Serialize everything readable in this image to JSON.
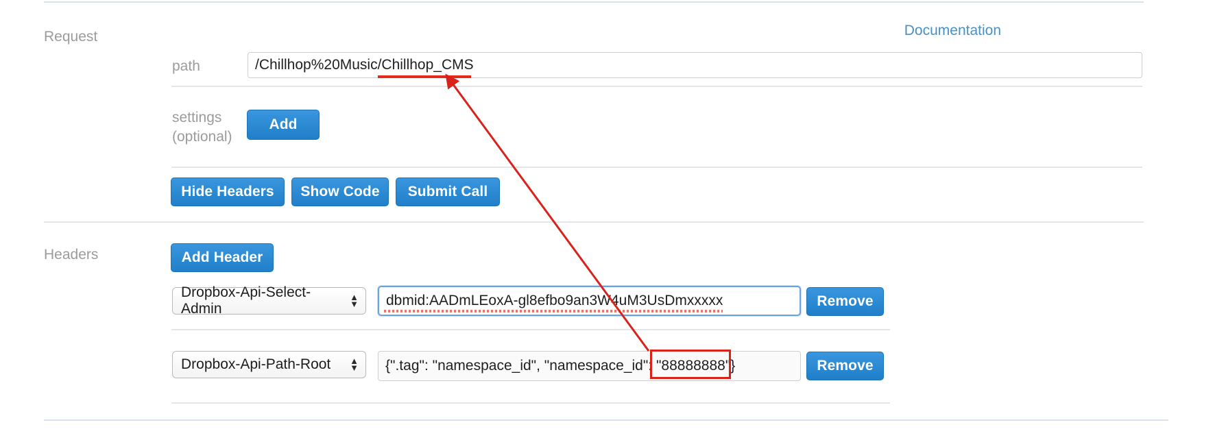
{
  "request": {
    "section_label": "Request",
    "documentation_link": "Documentation",
    "path": {
      "label": "path",
      "value": "/Chillhop%20Music/Chillhop_CMS",
      "placeholder": "path"
    },
    "settings": {
      "label": "settings\n(optional)",
      "add_label": "Add"
    },
    "actions": {
      "hide_headers": "Hide Headers",
      "show_code": "Show Code",
      "submit_call": "Submit Call"
    }
  },
  "headers": {
    "section_label": "Headers",
    "add_header_label": "Add Header",
    "rows": [
      {
        "name": "Dropbox-Api-Select-Admin",
        "value": "dbmid:AADmLEoxA-gl8efbo9an3W4uM3UsDmxxxxx",
        "remove_label": "Remove"
      },
      {
        "name": "Dropbox-Api-Path-Root",
        "value": "{\".tag\": \"namespace_id\", \"namespace_id\": \"88888888\"}",
        "remove_label": "Remove"
      }
    ]
  },
  "annotations": {
    "arrow_color": "#d8221a",
    "highlight_rect_color": "#d8221a",
    "underline_color": "#e02b1d"
  },
  "icons": {
    "select_up_arrow": "▲",
    "select_down_arrow": "▼"
  },
  "colors": {
    "button_blue": "#2585d3",
    "link_blue": "#4a90c4",
    "label_gray": "#9b9b9b",
    "divider_blue": "#d6e2ef",
    "focus_border": "#6aa3e0"
  }
}
